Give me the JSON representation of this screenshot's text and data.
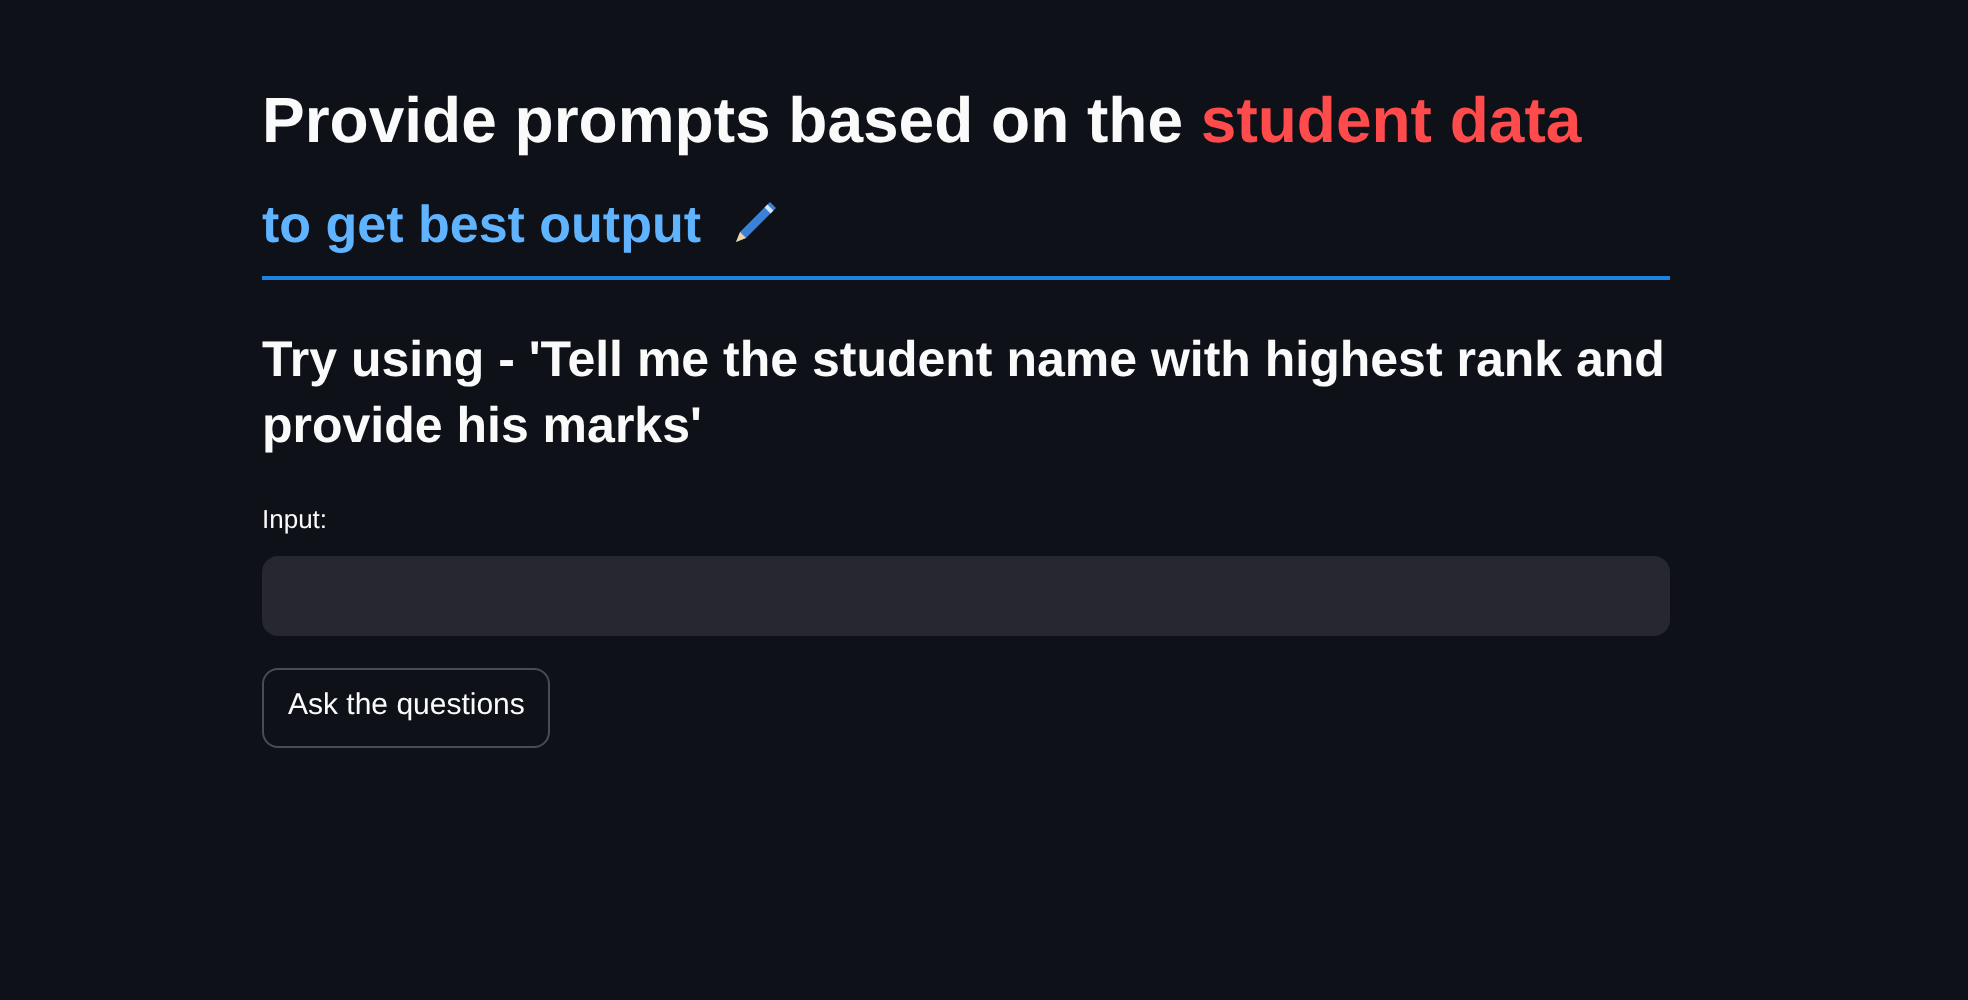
{
  "title": {
    "text": "Provide prompts based on the",
    "highlight": "student data"
  },
  "subheader": {
    "text": "to get best output",
    "divider": true
  },
  "hint": "Try using - 'Tell me the student name with highest rank and provide his marks'",
  "input": {
    "label": "Input:"
  },
  "button": "Ask the questions"
}
